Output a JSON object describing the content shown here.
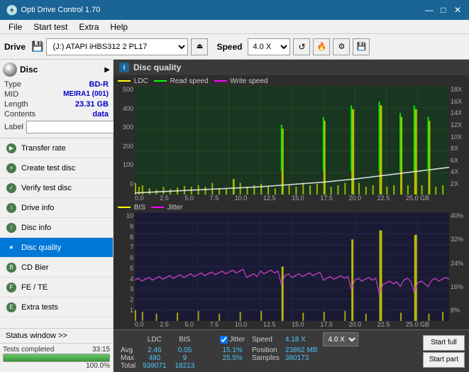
{
  "titlebar": {
    "icon": "💿",
    "title": "Opti Drive Control 1.70",
    "minimize": "—",
    "maximize": "□",
    "close": "✕"
  },
  "menu": {
    "items": [
      "File",
      "Start test",
      "Extra",
      "Help"
    ]
  },
  "toolbar": {
    "drive_label": "Drive",
    "drive_value": "(J:) ATAPI iHBS312  2 PL17",
    "speed_label": "Speed",
    "speed_value": "4.0 X"
  },
  "disc": {
    "title": "Disc",
    "type_label": "Type",
    "type_value": "BD-R",
    "mid_label": "MID",
    "mid_value": "MEIRA1 (001)",
    "length_label": "Length",
    "length_value": "23.31 GB",
    "contents_label": "Contents",
    "contents_value": "data",
    "label_label": "Label",
    "label_value": ""
  },
  "nav": {
    "items": [
      {
        "id": "transfer-rate",
        "label": "Transfer rate",
        "color": "#4a7a4a"
      },
      {
        "id": "create-test-disc",
        "label": "Create test disc",
        "color": "#4a7a4a"
      },
      {
        "id": "verify-test-disc",
        "label": "Verify test disc",
        "color": "#4a7a4a"
      },
      {
        "id": "drive-info",
        "label": "Drive info",
        "color": "#4a7a4a"
      },
      {
        "id": "disc-info",
        "label": "Disc info",
        "color": "#4a7a4a"
      },
      {
        "id": "disc-quality",
        "label": "Disc quality",
        "color": "#0078d7",
        "active": true
      },
      {
        "id": "cd-bier",
        "label": "CD Bier",
        "color": "#4a7a4a"
      },
      {
        "id": "fe-te",
        "label": "FE / TE",
        "color": "#4a7a4a"
      },
      {
        "id": "extra-tests",
        "label": "Extra tests",
        "color": "#4a7a4a"
      }
    ]
  },
  "status_window": "Status window >>",
  "progress": {
    "value": 100,
    "label": "100.0%"
  },
  "status": {
    "text": "Tests completed",
    "time": "33:15"
  },
  "chart": {
    "title": "Disc quality",
    "upper_legend": {
      "ldc_label": "LDC",
      "ldc_color": "#ffff00",
      "read_label": "Read speed",
      "read_color": "#00ff00",
      "write_label": "Write speed",
      "write_color": "#ff00ff"
    },
    "lower_legend": {
      "bis_label": "BIS",
      "bis_color": "#ffff00",
      "jitter_label": "Jitter",
      "jitter_color": "#ff00ff"
    },
    "upper_y_labels": [
      "500",
      "400",
      "300",
      "200",
      "100",
      "0"
    ],
    "upper_y_right": [
      "18X",
      "16X",
      "14X",
      "12X",
      "10X",
      "8X",
      "6X",
      "4X",
      "2X"
    ],
    "lower_y_labels": [
      "10",
      "9",
      "8",
      "7",
      "6",
      "5",
      "4",
      "3",
      "2",
      "1"
    ],
    "lower_y_right": [
      "40%",
      "32%",
      "24%",
      "16%",
      "8%"
    ],
    "x_labels": [
      "0.0",
      "2.5",
      "5.0",
      "7.5",
      "10.0",
      "12.5",
      "15.0",
      "17.5",
      "20.0",
      "22.5",
      "25.0 GB"
    ]
  },
  "stats": {
    "columns": {
      "ldc": "LDC",
      "bis": "BIS",
      "jitter": "Jitter",
      "speed": "Speed",
      "position": "Position"
    },
    "jitter_checked": true,
    "rows": {
      "avg_label": "Avg",
      "max_label": "Max",
      "total_label": "Total",
      "ldc_avg": "2.46",
      "ldc_max": "480",
      "ldc_total": "939071",
      "bis_avg": "0.05",
      "bis_max": "9",
      "bis_total": "18213",
      "jitter_avg": "15.1%",
      "jitter_max": "25.5%",
      "jitter_total": "",
      "speed_label": "4.18 X",
      "speed_select": "4.0 X",
      "position_label": "23862 MB",
      "samples_label": "Samples",
      "samples_value": "380173"
    },
    "start_full": "Start full",
    "start_part": "Start part"
  }
}
